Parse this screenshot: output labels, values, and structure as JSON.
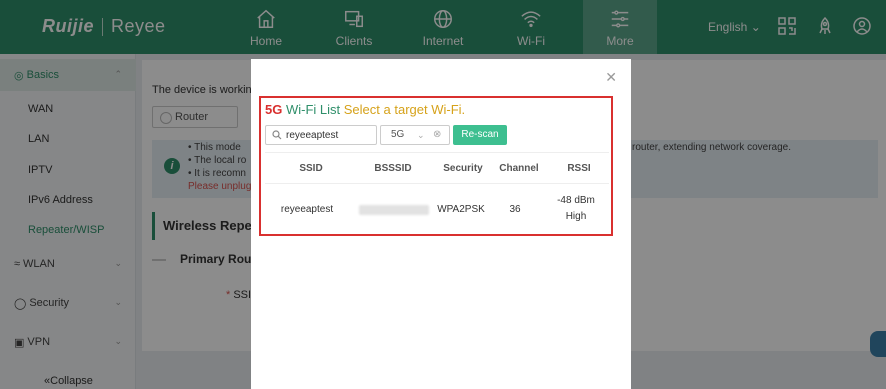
{
  "brand": {
    "logo": "Ruijie",
    "sub": "Reyee"
  },
  "nav": [
    {
      "label": "Home",
      "icon": "home-icon"
    },
    {
      "label": "Clients",
      "icon": "clients-icon"
    },
    {
      "label": "Internet",
      "icon": "globe-icon"
    },
    {
      "label": "Wi-Fi",
      "icon": "wifi-icon"
    },
    {
      "label": "More",
      "icon": "more-icon",
      "active": true
    }
  ],
  "topright": {
    "language": "English"
  },
  "sidebar": {
    "groups": {
      "basics": "Basics",
      "wlan": "WLAN",
      "security": "Security",
      "vpn": "VPN"
    },
    "items": [
      "WAN",
      "LAN",
      "IPTV",
      "IPv6 Address",
      "Repeater/WISP"
    ],
    "collapse": "Collapse"
  },
  "main": {
    "line1": "The device is working",
    "mode": "Router",
    "info": {
      "l1": "This mode",
      "l2": "The local ro",
      "l3": "It is recomn",
      "warn": "Please unplug",
      "right": "router, extending network coverage."
    },
    "section": "Wireless Repea",
    "subsection": "Primary Rou",
    "ssid_label": "SSID"
  },
  "modal": {
    "title_band": "5G",
    "title_list": "Wi-Fi List",
    "title_select": "Select a target Wi-Fi.",
    "search_value": "reyeeaptest",
    "band": "5G",
    "rescan": "Re-scan",
    "columns": [
      "SSID",
      "BSSSID",
      "Security",
      "Channel",
      "RSSI"
    ],
    "rows": [
      {
        "ssid": "reyeeaptest",
        "security": "WPA2PSK",
        "channel": "36",
        "rssi": "-48 dBm",
        "quality": "High"
      }
    ]
  },
  "colors": {
    "brand": "#2f8f6a",
    "highlight": "#d9302f",
    "button": "#3dbf90"
  }
}
